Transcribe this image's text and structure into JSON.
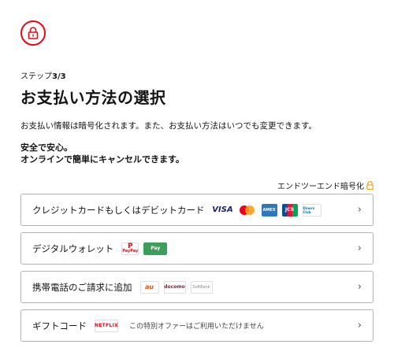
{
  "header": {
    "lock_icon": "lock-icon"
  },
  "step": {
    "prefix": "ステップ",
    "current": "3/3"
  },
  "title": "お支払い方法の選択",
  "description": "お支払い情報は暗号化されます。また、お支払い方法はいつでも変更できます。",
  "safe": {
    "line1": "安全で安心。",
    "line2": "オンラインで簡単にキャンセルできます。"
  },
  "encryption": {
    "label": "エンドツーエンド暗号化",
    "icon": "lock-icon",
    "color": "#f5a623"
  },
  "brand_color": "#e50914",
  "options": [
    {
      "label": "クレジットカードもしくはデビットカード",
      "logos": [
        "VISA",
        "Mastercard",
        "AMEX",
        "JCB",
        "Diners Club"
      ]
    },
    {
      "label": "デジタルウォレット",
      "logos": [
        "PayPay",
        "Pay"
      ]
    },
    {
      "label": "携帯電話のご請求に追加",
      "logos": [
        "au",
        "docomo",
        "SoftBank"
      ]
    },
    {
      "label": "ギフトコード",
      "logos": [
        "NETFLIX"
      ],
      "note": "この特別オファーはご利用いただけません"
    }
  ],
  "chevron": "›"
}
